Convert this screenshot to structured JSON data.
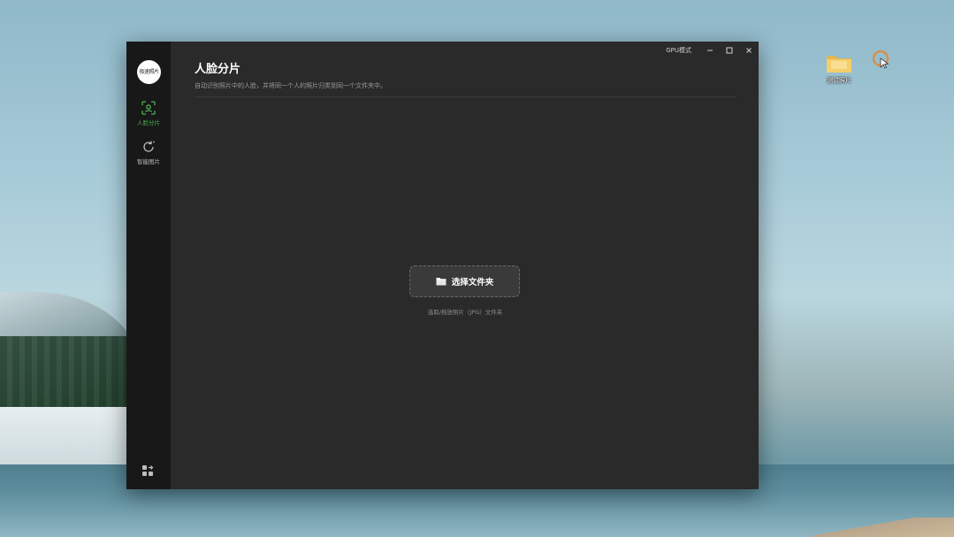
{
  "app": {
    "logo_text": "极速照片",
    "sidebar": {
      "items": [
        {
          "label": "人脸分片",
          "icon": "face-scan-icon",
          "active": true
        },
        {
          "label": "智能图片",
          "icon": "smart-refresh-icon",
          "active": false
        }
      ],
      "apps_icon": "apps-grid-icon"
    },
    "titlebar": {
      "gpu_mode_label": "GPU模式",
      "minimize_icon": "minimize-icon",
      "maximize_icon": "maximize-icon",
      "close_icon": "close-icon"
    },
    "main": {
      "title": "人脸分片",
      "subtitle": "自动识别照片中的人脸，并将同一个人的照片归类到同一个文件夹中。",
      "select_button_label": "选择文件夹",
      "select_hint": "选取/拖放照片（JPG）文件夹"
    }
  },
  "desktop": {
    "icons": [
      {
        "label": "测试照片",
        "icon": "folder-icon"
      }
    ]
  },
  "colors": {
    "accent": "#4caf50",
    "window_bg": "#2a2a2a",
    "sidebar_bg": "#181818"
  }
}
